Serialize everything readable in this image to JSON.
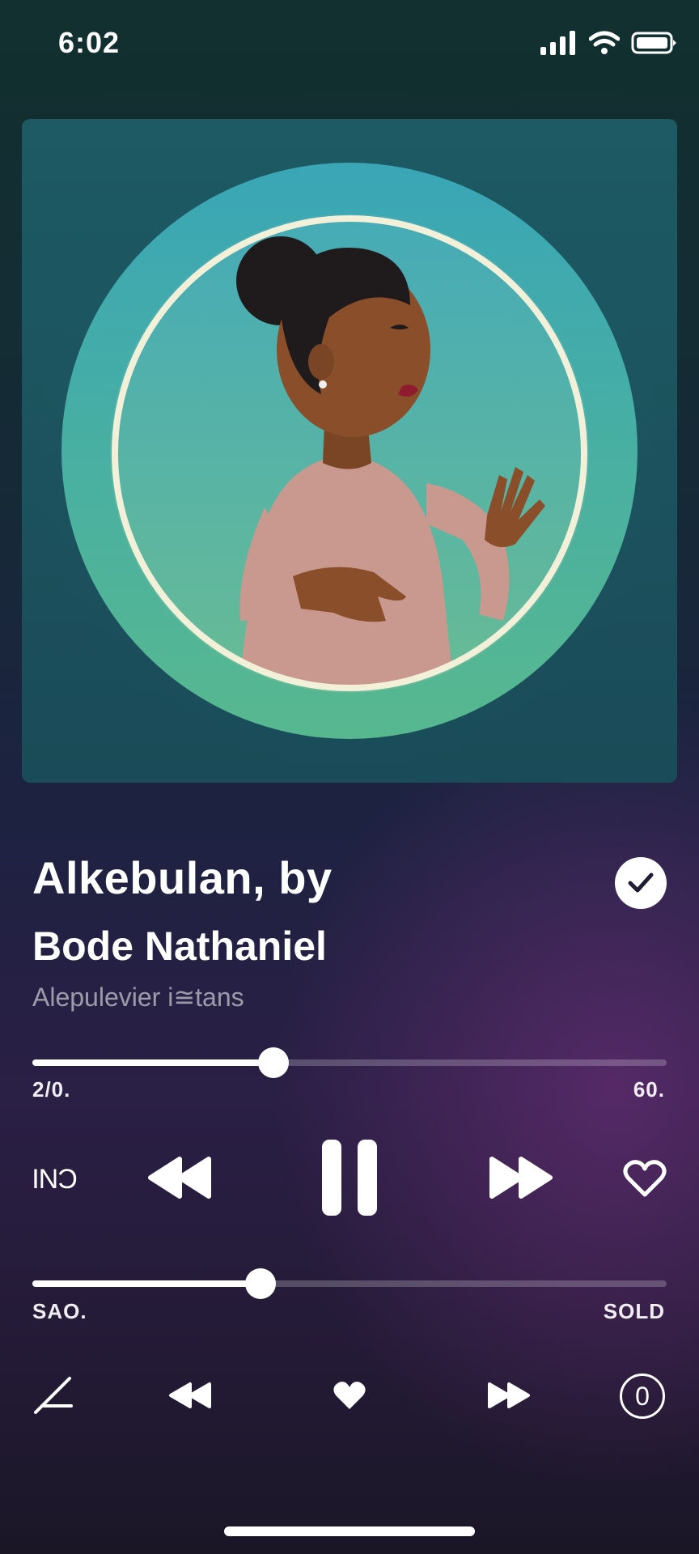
{
  "status_bar": {
    "time": "6:02",
    "icons": [
      "signal-icon",
      "wifi-icon",
      "battery-icon"
    ]
  },
  "artwork": {
    "description_icon": "portrait-illustration",
    "colors": {
      "background": "#1b5360",
      "outer_ring": "#3aa0ae",
      "inner_circle": "#5db7b3",
      "ring": "#f2f0d8"
    }
  },
  "track": {
    "title": "Alkebulan, by",
    "artist": "Bode Nathaniel",
    "album": "Alepulevier i≅tans",
    "saved_icon": "checkmark-icon"
  },
  "progress": {
    "elapsed": "2/0.",
    "total": "60.",
    "fraction": 0.38
  },
  "controls": {
    "repeat_label": "INƆ",
    "rewind_icon": "rewind-icon",
    "pause_icon": "pause-icon",
    "forward_icon": "fast-forward-icon",
    "like_icon": "heart-outline-icon"
  },
  "volume": {
    "left_label": "SAO.",
    "right_label": "SOLD",
    "fraction": 0.36
  },
  "bottom_bar": {
    "icons": [
      "slash-icon",
      "skip-back-icon",
      "heart-filled-icon",
      "skip-forward-icon",
      "zero-circle-icon"
    ],
    "circle_label": "0"
  },
  "colors": {
    "accent": "#ffffff",
    "track_background": "rgba(255,255,255,0.22)"
  }
}
